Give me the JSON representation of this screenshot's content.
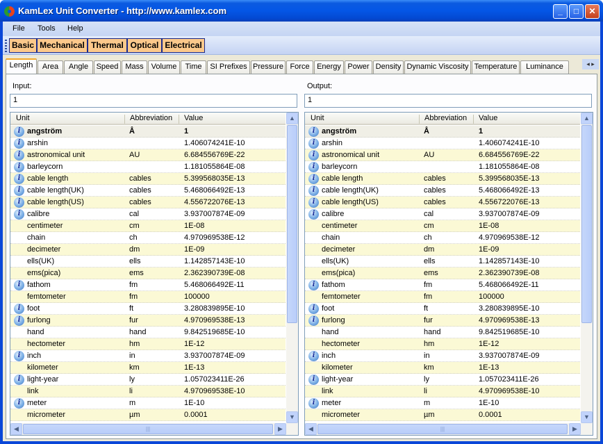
{
  "window": {
    "title": "KamLex Unit Converter - http://www.kamlex.com",
    "minimize": "_",
    "maximize": "□",
    "close": "✕"
  },
  "menu": [
    "File",
    "Tools",
    "Help"
  ],
  "categories": [
    "Basic",
    "Mechanical",
    "Thermal",
    "Optical",
    "Electrical"
  ],
  "tabs": [
    "Length",
    "Area",
    "Angle",
    "Speed",
    "Mass",
    "Volume",
    "Time",
    "SI Prefixes",
    "Pressure",
    "Force",
    "Energy",
    "Power",
    "Density",
    "Dynamic Viscosity",
    "Temperature",
    "Luminance"
  ],
  "active_tab": "Length",
  "tab_scroll": "◂ ▸",
  "input": {
    "label": "Input:",
    "value": "1"
  },
  "output": {
    "label": "Output:",
    "value": "1"
  },
  "columns": [
    "Unit",
    "Abbreviation",
    "Value"
  ],
  "rows": [
    {
      "unit": "angström",
      "abbr": "Å",
      "value": "1",
      "info": true,
      "selected": true
    },
    {
      "unit": "arshin",
      "abbr": "",
      "value": "1.406074241E-10",
      "info": true
    },
    {
      "unit": "astronomical unit",
      "abbr": "AU",
      "value": "6.684556769E-22",
      "info": true
    },
    {
      "unit": "barleycorn",
      "abbr": "",
      "value": "1.181055864E-08",
      "info": true
    },
    {
      "unit": "cable length",
      "abbr": "cables",
      "value": "5.399568035E-13",
      "info": true
    },
    {
      "unit": "cable length(UK)",
      "abbr": "cables",
      "value": "5.468066492E-13",
      "info": true
    },
    {
      "unit": "cable length(US)",
      "abbr": "cables",
      "value": "4.556722076E-13",
      "info": true
    },
    {
      "unit": "calibre",
      "abbr": "cal",
      "value": "3.937007874E-09",
      "info": true
    },
    {
      "unit": "centimeter",
      "abbr": "cm",
      "value": "1E-08",
      "info": false
    },
    {
      "unit": "chain",
      "abbr": "ch",
      "value": "4.970969538E-12",
      "info": false
    },
    {
      "unit": "decimeter",
      "abbr": "dm",
      "value": "1E-09",
      "info": false
    },
    {
      "unit": "ells(UK)",
      "abbr": "ells",
      "value": "1.142857143E-10",
      "info": false
    },
    {
      "unit": "ems(pica)",
      "abbr": "ems",
      "value": "2.362390739E-08",
      "info": false
    },
    {
      "unit": "fathom",
      "abbr": "fm",
      "value": "5.468066492E-11",
      "info": true
    },
    {
      "unit": "femtometer",
      "abbr": "fm",
      "value": "100000",
      "info": false
    },
    {
      "unit": "foot",
      "abbr": "ft",
      "value": "3.280839895E-10",
      "info": true
    },
    {
      "unit": "furlong",
      "abbr": "fur",
      "value": "4.970969538E-13",
      "info": true
    },
    {
      "unit": "hand",
      "abbr": "hand",
      "value": "9.842519685E-10",
      "info": false
    },
    {
      "unit": "hectometer",
      "abbr": "hm",
      "value": "1E-12",
      "info": false
    },
    {
      "unit": "inch",
      "abbr": "in",
      "value": "3.937007874E-09",
      "info": true
    },
    {
      "unit": "kilometer",
      "abbr": "km",
      "value": "1E-13",
      "info": false
    },
    {
      "unit": "light-year",
      "abbr": "ly",
      "value": "1.057023411E-26",
      "info": true
    },
    {
      "unit": "link",
      "abbr": "li",
      "value": "4.970969538E-10",
      "info": false
    },
    {
      "unit": "meter",
      "abbr": "m",
      "value": "1E-10",
      "info": true
    },
    {
      "unit": "micrometer",
      "abbr": "µm",
      "value": "0.0001",
      "info": false
    }
  ],
  "scroll": {
    "up": "▲",
    "down": "▼",
    "left": "◀",
    "right": "▶",
    "grip": "|||"
  }
}
